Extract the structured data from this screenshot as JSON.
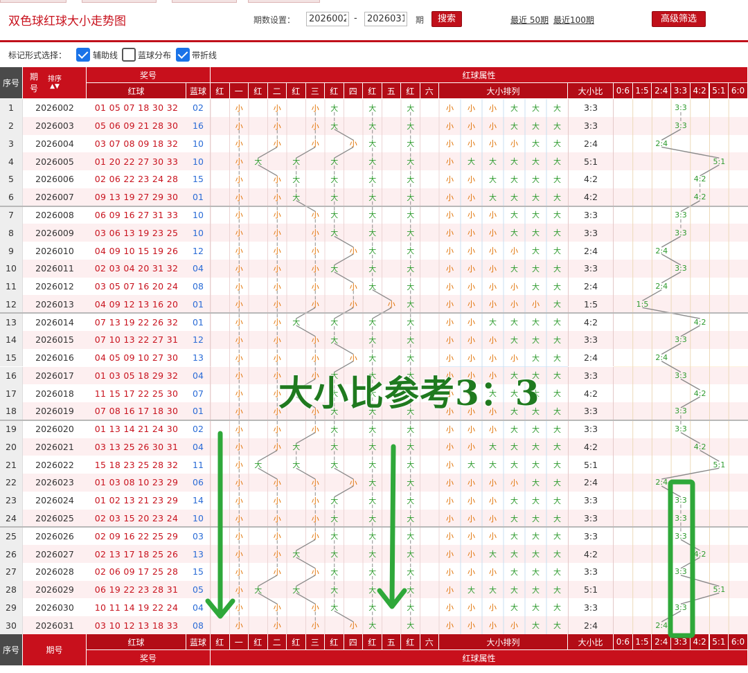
{
  "header": {
    "title": "双色球红球大小走势图",
    "period_label": "期数设置：",
    "from": "2026002",
    "to": "2026031",
    "period_unit": "期",
    "search": "搜索",
    "recent50": "最近 50期",
    "recent100": "最近100期",
    "advanced": "高级筛选"
  },
  "marker": {
    "label": "标记形式选择：",
    "options": [
      {
        "label": "辅助线",
        "checked": true
      },
      {
        "label": "蓝球分布",
        "checked": false
      },
      {
        "label": "带折线",
        "checked": true
      }
    ]
  },
  "table_head": {
    "seq": "序号",
    "issue": "期号",
    "issue_a": "期",
    "issue_b": "号",
    "sort": "排序",
    "prize": "奖号",
    "red": "红球",
    "blue": "蓝球",
    "attr": "红球属性",
    "pos_cols": [
      "红",
      "一",
      "红",
      "二",
      "红",
      "三",
      "红",
      "四",
      "红",
      "五",
      "红",
      "六"
    ],
    "rank": "大小排列",
    "ratio": "大小比",
    "ratio_cols": [
      "0:6",
      "1:5",
      "2:4",
      "3:3",
      "4:2",
      "5:1",
      "6:0"
    ]
  },
  "colors": {
    "accent": "#c8101c",
    "small": "#e07000",
    "big": "#2e9b2e",
    "blue_ball": "#2a6bd6"
  },
  "rows": [
    {
      "seq": "1",
      "issue": "2026002",
      "red": "01 05 07 18 30 32",
      "blue": "02",
      "pos": [
        "小",
        "小",
        "小",
        "大",
        "大",
        "大"
      ],
      "ratio": "3:3"
    },
    {
      "seq": "2",
      "issue": "2026003",
      "red": "05 06 09 21 28 30",
      "blue": "16",
      "pos": [
        "小",
        "小",
        "小",
        "大",
        "大",
        "大"
      ],
      "ratio": "3:3"
    },
    {
      "seq": "3",
      "issue": "2026004",
      "red": "03 07 08 09 18 32",
      "blue": "10",
      "pos": [
        "小",
        "小",
        "小",
        "小",
        "大",
        "大"
      ],
      "ratio": "2:4"
    },
    {
      "seq": "4",
      "issue": "2026005",
      "red": "01 20 22 27 30 33",
      "blue": "10",
      "pos": [
        "小",
        "大",
        "大",
        "大",
        "大",
        "大"
      ],
      "ratio": "5:1"
    },
    {
      "seq": "5",
      "issue": "2026006",
      "red": "02 06 22 23 24 28",
      "blue": "15",
      "pos": [
        "小",
        "小",
        "大",
        "大",
        "大",
        "大"
      ],
      "ratio": "4:2"
    },
    {
      "seq": "6",
      "issue": "2026007",
      "red": "09 13 19 27 29 30",
      "blue": "01",
      "pos": [
        "小",
        "小",
        "大",
        "大",
        "大",
        "大"
      ],
      "ratio": "4:2"
    },
    {
      "seq": "7",
      "issue": "2026008",
      "red": "06 09 16 27 31 33",
      "blue": "10",
      "pos": [
        "小",
        "小",
        "小",
        "大",
        "大",
        "大"
      ],
      "ratio": "3:3"
    },
    {
      "seq": "8",
      "issue": "2026009",
      "red": "03 06 13 19 23 25",
      "blue": "10",
      "pos": [
        "小",
        "小",
        "小",
        "大",
        "大",
        "大"
      ],
      "ratio": "3:3"
    },
    {
      "seq": "9",
      "issue": "2026010",
      "red": "04 09 10 15 19 26",
      "blue": "12",
      "pos": [
        "小",
        "小",
        "小",
        "小",
        "大",
        "大"
      ],
      "ratio": "2:4"
    },
    {
      "seq": "10",
      "issue": "2026011",
      "red": "02 03 04 20 31 32",
      "blue": "04",
      "pos": [
        "小",
        "小",
        "小",
        "大",
        "大",
        "大"
      ],
      "ratio": "3:3"
    },
    {
      "seq": "11",
      "issue": "2026012",
      "red": "03 05 07 16 20 24",
      "blue": "08",
      "pos": [
        "小",
        "小",
        "小",
        "小",
        "大",
        "大"
      ],
      "ratio": "2:4"
    },
    {
      "seq": "12",
      "issue": "2026013",
      "red": "04 09 12 13 16 20",
      "blue": "01",
      "pos": [
        "小",
        "小",
        "小",
        "小",
        "小",
        "大"
      ],
      "ratio": "1:5"
    },
    {
      "seq": "13",
      "issue": "2026014",
      "red": "07 13 19 22 26 32",
      "blue": "01",
      "pos": [
        "小",
        "小",
        "大",
        "大",
        "大",
        "大"
      ],
      "ratio": "4:2"
    },
    {
      "seq": "14",
      "issue": "2026015",
      "red": "07 10 13 22 27 31",
      "blue": "12",
      "pos": [
        "小",
        "小",
        "小",
        "大",
        "大",
        "大"
      ],
      "ratio": "3:3"
    },
    {
      "seq": "15",
      "issue": "2026016",
      "red": "04 05 09 10 27 30",
      "blue": "13",
      "pos": [
        "小",
        "小",
        "小",
        "小",
        "大",
        "大"
      ],
      "ratio": "2:4"
    },
    {
      "seq": "16",
      "issue": "2026017",
      "red": "01 03 05 18 29 32",
      "blue": "04",
      "pos": [
        "小",
        "小",
        "小",
        "大",
        "大",
        "大"
      ],
      "ratio": "3:3"
    },
    {
      "seq": "17",
      "issue": "2026018",
      "red": "11 15 17 22 25 30",
      "blue": "07",
      "pos": [
        "小",
        "小",
        "大",
        "大",
        "大",
        "大"
      ],
      "ratio": "4:2"
    },
    {
      "seq": "18",
      "issue": "2026019",
      "red": "07 08 16 17 18 30",
      "blue": "01",
      "pos": [
        "小",
        "小",
        "小",
        "大",
        "大",
        "大"
      ],
      "ratio": "3:3"
    },
    {
      "seq": "19",
      "issue": "2026020",
      "red": "01 13 14 21 24 30",
      "blue": "02",
      "pos": [
        "小",
        "小",
        "小",
        "大",
        "大",
        "大"
      ],
      "ratio": "3:3"
    },
    {
      "seq": "20",
      "issue": "2026021",
      "red": "03 13 25 26 30 31",
      "blue": "04",
      "pos": [
        "小",
        "小",
        "大",
        "大",
        "大",
        "大"
      ],
      "ratio": "4:2"
    },
    {
      "seq": "21",
      "issue": "2026022",
      "red": "15 18 23 25 28 32",
      "blue": "11",
      "pos": [
        "小",
        "大",
        "大",
        "大",
        "大",
        "大"
      ],
      "ratio": "5:1"
    },
    {
      "seq": "22",
      "issue": "2026023",
      "red": "01 03 08 10 23 29",
      "blue": "06",
      "pos": [
        "小",
        "小",
        "小",
        "小",
        "大",
        "大"
      ],
      "ratio": "2:4"
    },
    {
      "seq": "23",
      "issue": "2026024",
      "red": "01 02 13 21 23 29",
      "blue": "14",
      "pos": [
        "小",
        "小",
        "小",
        "大",
        "大",
        "大"
      ],
      "ratio": "3:3"
    },
    {
      "seq": "24",
      "issue": "2026025",
      "red": "02 03 15 20 23 24",
      "blue": "10",
      "pos": [
        "小",
        "小",
        "小",
        "大",
        "大",
        "大"
      ],
      "ratio": "3:3"
    },
    {
      "seq": "25",
      "issue": "2026026",
      "red": "02 09 16 22 25 29",
      "blue": "03",
      "pos": [
        "小",
        "小",
        "小",
        "大",
        "大",
        "大"
      ],
      "ratio": "3:3"
    },
    {
      "seq": "26",
      "issue": "2026027",
      "red": "02 13 17 18 25 26",
      "blue": "13",
      "pos": [
        "小",
        "小",
        "大",
        "大",
        "大",
        "大"
      ],
      "ratio": "4:2"
    },
    {
      "seq": "27",
      "issue": "2026028",
      "red": "02 06 09 17 25 28",
      "blue": "15",
      "pos": [
        "小",
        "小",
        "小",
        "大",
        "大",
        "大"
      ],
      "ratio": "3:3"
    },
    {
      "seq": "28",
      "issue": "2026029",
      "red": "06 19 22 23 28 31",
      "blue": "05",
      "pos": [
        "小",
        "大",
        "大",
        "大",
        "大",
        "大"
      ],
      "ratio": "5:1"
    },
    {
      "seq": "29",
      "issue": "2026030",
      "red": "10 11 14 19 22 24",
      "blue": "04",
      "pos": [
        "小",
        "小",
        "小",
        "大",
        "大",
        "大"
      ],
      "ratio": "3:3"
    },
    {
      "seq": "30",
      "issue": "2026031",
      "red": "03 10 12 13 18 33",
      "blue": "08",
      "pos": [
        "小",
        "小",
        "小",
        "小",
        "大",
        "大"
      ],
      "ratio": "2:4"
    }
  ],
  "overlay_text": "大小比参考3：3"
}
